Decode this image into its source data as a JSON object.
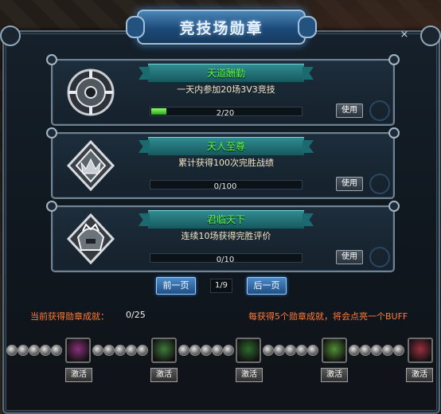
{
  "window": {
    "title": "竞技场勋章",
    "close": "×"
  },
  "cards": [
    {
      "name": "天道酬勤",
      "desc": "一天内参加20场3V3竞技",
      "progress_text": "2/20",
      "progress": 0.1,
      "button": "使用"
    },
    {
      "name": "天人至尊",
      "desc": "累计获得100次完胜战绩",
      "progress_text": "0/100",
      "progress": 0.0,
      "button": "使用"
    },
    {
      "name": "君临天下",
      "desc": "连续10场获得完胜评价",
      "progress_text": "0/10",
      "progress": 0.0,
      "button": "使用"
    }
  ],
  "pagination": {
    "prev": "前一页",
    "page": "1/9",
    "next": "后一页"
  },
  "achievement": {
    "label": "当前获得勋章成就：",
    "value": "0/25",
    "note": "每获得5个勋章成就，将会点亮一个BUFF"
  },
  "rewards": [
    {
      "icon": "purple-cloak-icon",
      "button": "激活",
      "color": "#8a2f7a"
    },
    {
      "icon": "green-beast-icon",
      "button": "激活",
      "color": "#3f7a3a"
    },
    {
      "icon": "green-figure-icon",
      "button": "激活",
      "color": "#2c6b2c"
    },
    {
      "icon": "green-muscle-icon",
      "button": "激活",
      "color": "#4f8f34"
    },
    {
      "icon": "red-gem-icon",
      "button": "激活",
      "color": "#9a2f3e"
    }
  ]
}
